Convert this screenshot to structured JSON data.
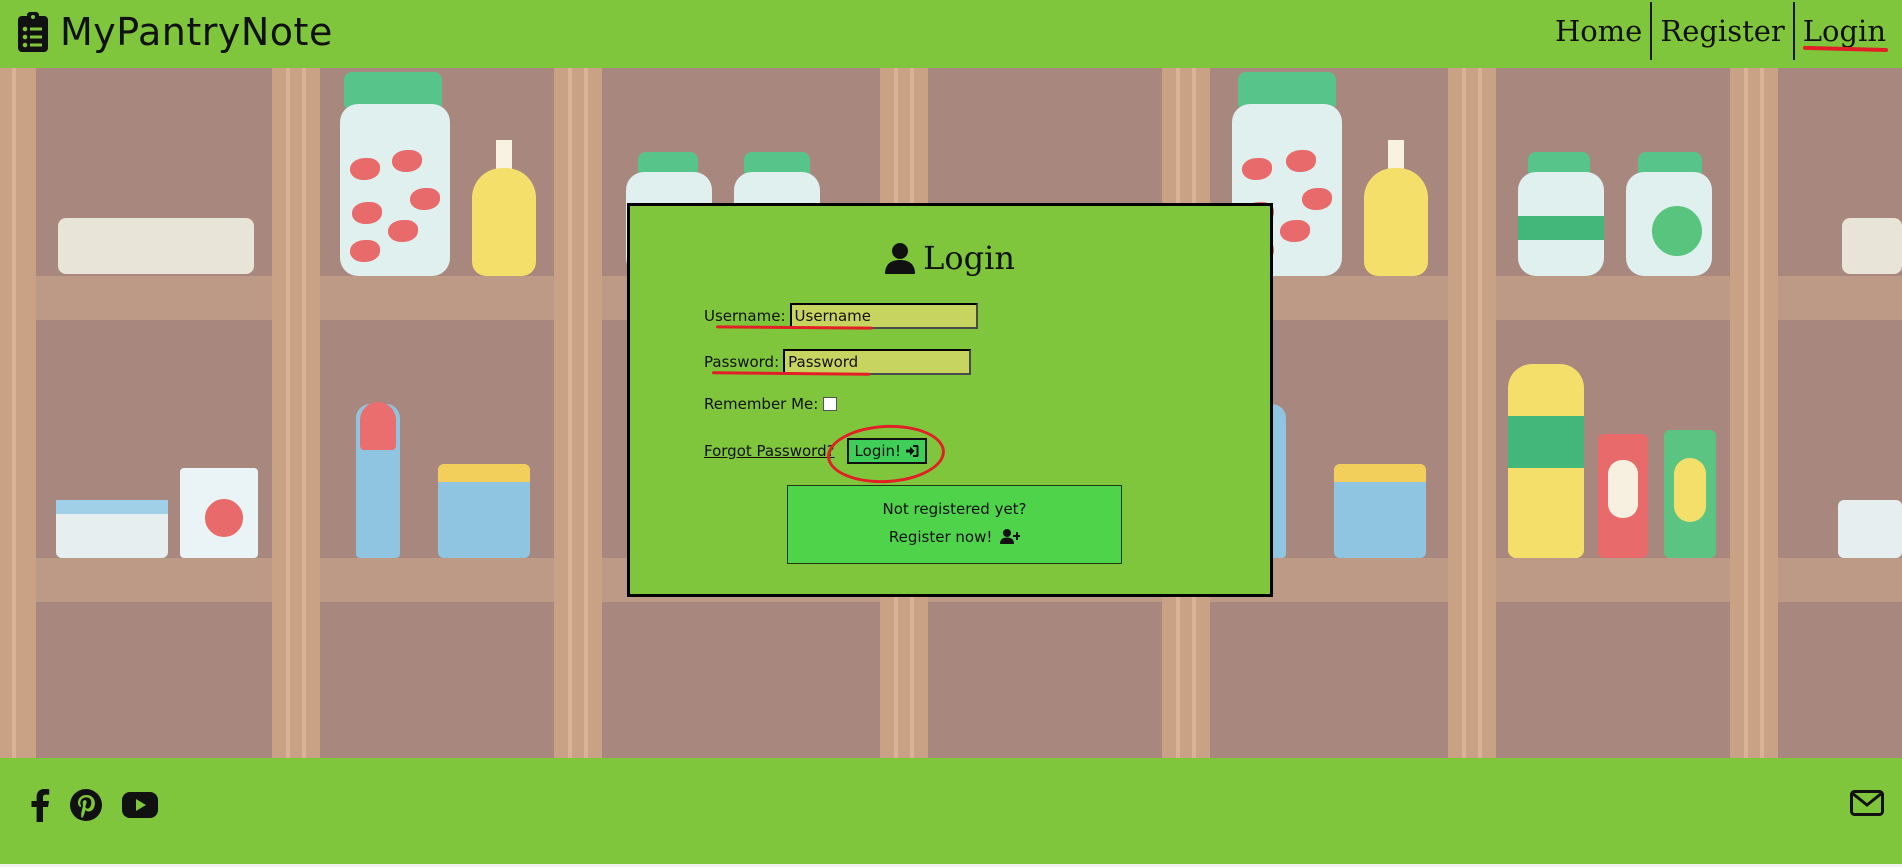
{
  "navbar": {
    "brand": "MyPantryNote",
    "links": [
      {
        "label": "Home"
      },
      {
        "label": "Register"
      },
      {
        "label": "Login",
        "active": true
      }
    ]
  },
  "login": {
    "title": "Login",
    "username_label": "Username:",
    "username_placeholder": "Username",
    "password_label": "Password:",
    "password_placeholder": "Password",
    "remember_label": "Remember Me:",
    "forgot_label": "Forgot Password?",
    "submit_label": "Login!",
    "register_line1": "Not registered yet?",
    "register_line2": "Register now!"
  },
  "footer": {
    "social": [
      "facebook-icon",
      "pinterest-icon",
      "youtube-icon"
    ],
    "contact": "envelope-icon"
  },
  "colors": {
    "nav_green": "#7fc63c",
    "input_yellow": "#c8d460",
    "button_green": "#3fcf58",
    "annotation_red": "#e21f26"
  }
}
